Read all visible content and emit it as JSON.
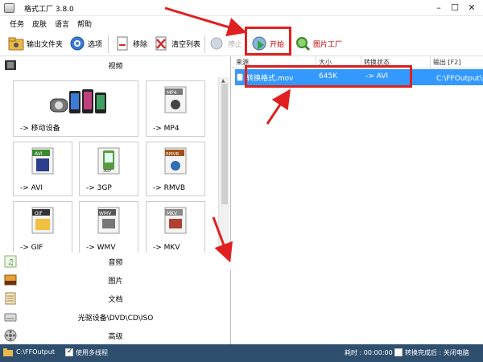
{
  "window": {
    "title": "格式工厂 3.8.0"
  },
  "menu": {
    "items": [
      "任务",
      "皮肤",
      "语言",
      "帮助"
    ]
  },
  "toolbar": {
    "output_folder": "输出文件夹",
    "options": "选项",
    "remove": "移除",
    "clear_list": "清空列表",
    "stop": "停止",
    "start": "开始",
    "picture_factory": "图片工厂"
  },
  "left": {
    "video_header": "视频",
    "tiles": {
      "mobile": {
        "label": "-> 移动设备"
      },
      "mp4": {
        "label": "-> MP4",
        "badge": "MP4"
      },
      "avi": {
        "label": "-> AVI",
        "badge": "AVI"
      },
      "3gp": {
        "label": "-> 3GP",
        "badge": "3GP"
      },
      "rmvb": {
        "label": "-> RMVB",
        "badge": "RMVB"
      },
      "gif": {
        "label": "-> GIF",
        "badge": "GIF"
      },
      "wmv": {
        "label": "-> WMV",
        "badge": "WMV"
      },
      "mkv": {
        "label": "-> MKV",
        "badge": "MKV"
      }
    },
    "categories": {
      "audio": "音频",
      "picture": "图片",
      "document": "文档",
      "rom": "光驱设备\\DVD\\CD\\ISO",
      "advanced": "高级"
    }
  },
  "list": {
    "headers": {
      "source": "来源",
      "size": "大小",
      "status": "转换状态",
      "output": "输出 [F2]"
    },
    "rows": [
      {
        "source": "转换格式.mov",
        "size": "645K",
        "status": "-> AVI",
        "output": "C:\\FFOutput\\转"
      }
    ]
  },
  "status": {
    "output_path": "C:\\FFOutput",
    "multithread": "使用多线程",
    "elapsed": "耗时 : 00:00:00",
    "shutdown": "转换完成后 : 关闭电脑"
  },
  "colors": {
    "selection": "#3399ff",
    "annotation": "#e02020",
    "statusbar": "#2f4f6f"
  }
}
